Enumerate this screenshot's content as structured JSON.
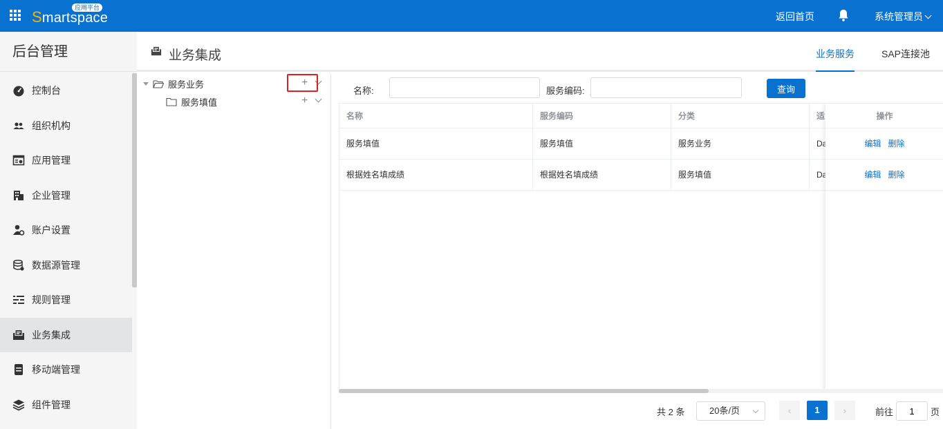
{
  "topbar": {
    "logo_first": "S",
    "logo_rest": "martspace",
    "logo_badge": "应用平台",
    "home_link": "返回首页",
    "user": "系统管理员",
    "bg_color": "#0972d0"
  },
  "sidebar": {
    "title": "后台管理",
    "items": [
      {
        "label": "控制台",
        "icon": "dashboard-icon"
      },
      {
        "label": "组织机构",
        "icon": "users-icon"
      },
      {
        "label": "应用管理",
        "icon": "app-settings-icon"
      },
      {
        "label": "企业管理",
        "icon": "building-icon"
      },
      {
        "label": "账户设置",
        "icon": "user-settings-icon"
      },
      {
        "label": "数据源管理",
        "icon": "database-icon"
      },
      {
        "label": "规则管理",
        "icon": "sliders-icon"
      },
      {
        "label": "业务集成",
        "icon": "integration-icon"
      },
      {
        "label": "移动端管理",
        "icon": "mobile-icon"
      },
      {
        "label": "组件管理",
        "icon": "layers-icon"
      }
    ],
    "active": "业务集成"
  },
  "header": {
    "title": "业务集成",
    "tabs": [
      "业务服务",
      "SAP连接池"
    ],
    "active_tab": "业务服务"
  },
  "tree": {
    "root": "服务业务",
    "child": "服务填值"
  },
  "search": {
    "name_label": "名称:",
    "name_value": "",
    "code_label": "服务编码:",
    "code_value": "",
    "query_button": "查询"
  },
  "table": {
    "columns": [
      "名称",
      "服务编码",
      "分类",
      "适",
      "操作"
    ],
    "rows": [
      {
        "name": "服务填值",
        "code": "服务填值",
        "category": "服务业务",
        "extra": "Da"
      },
      {
        "name": "根据姓名填成绩",
        "code": "根据姓名填成绩",
        "category": "服务填值",
        "extra": "Da"
      }
    ],
    "edit_label": "编辑",
    "delete_label": "删除"
  },
  "pagination": {
    "total_text": "共 2 条",
    "page_size": "20条/页",
    "current_page": "1",
    "goto_label": "前往",
    "goto_value": "1",
    "page_suffix": "页"
  }
}
